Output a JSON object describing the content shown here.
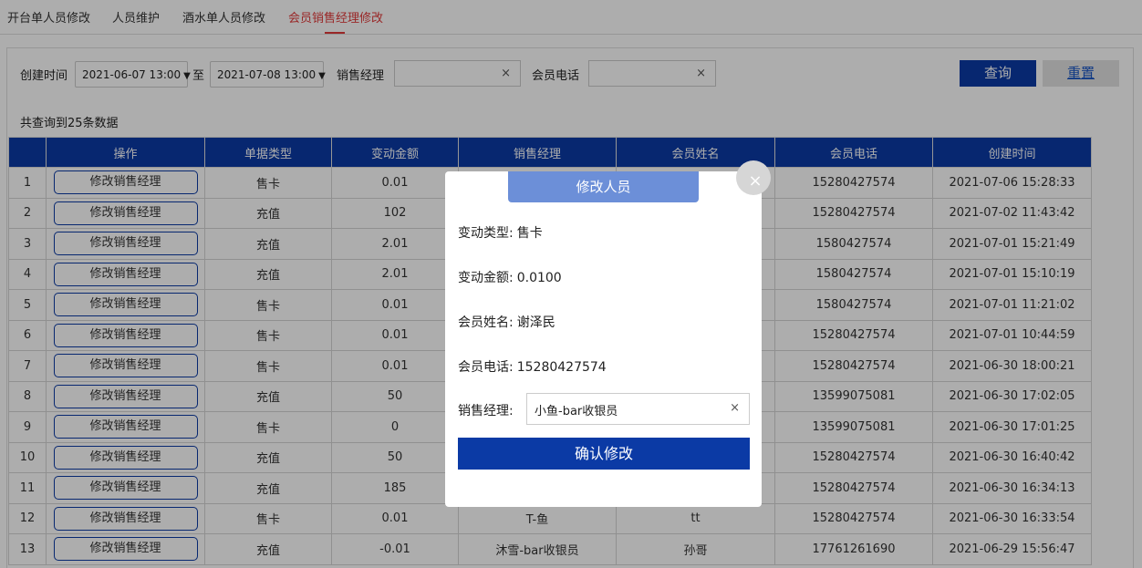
{
  "tabs": [
    {
      "label": "开台单人员修改"
    },
    {
      "label": "人员维护"
    },
    {
      "label": "酒水单人员修改"
    },
    {
      "label": "会员销售经理修改"
    }
  ],
  "filters": {
    "created_label": "创建时间",
    "start_date": "2021-06-07 13:00",
    "to_label": "至",
    "end_date": "2021-07-08 13:00",
    "manager_label": "销售经理",
    "manager_value": "",
    "phone_label": "会员电话",
    "phone_value": "",
    "query_label": "查询",
    "reset_label": "重置"
  },
  "result_count": "共查询到25条数据",
  "table": {
    "headers": [
      "操作",
      "单据类型",
      "变动金额",
      "销售经理",
      "会员姓名",
      "会员电话",
      "创建时间"
    ],
    "action_label": "修改销售经理",
    "rows": [
      {
        "no": "1",
        "type": "售卡",
        "amount": "0.01",
        "manager": "",
        "name": "",
        "phone": "15280427574",
        "time": "2021-07-06 15:28:33"
      },
      {
        "no": "2",
        "type": "充值",
        "amount": "102",
        "manager": "",
        "name": "",
        "phone": "15280427574",
        "time": "2021-07-02 11:43:42"
      },
      {
        "no": "3",
        "type": "充值",
        "amount": "2.01",
        "manager": "",
        "name": "",
        "phone": "1580427574",
        "time": "2021-07-01 15:21:49"
      },
      {
        "no": "4",
        "type": "充值",
        "amount": "2.01",
        "manager": "",
        "name": "",
        "phone": "1580427574",
        "time": "2021-07-01 15:10:19"
      },
      {
        "no": "5",
        "type": "售卡",
        "amount": "0.01",
        "manager": "",
        "name": "",
        "phone": "1580427574",
        "time": "2021-07-01 11:21:02"
      },
      {
        "no": "6",
        "type": "售卡",
        "amount": "0.01",
        "manager": "",
        "name": "",
        "phone": "15280427574",
        "time": "2021-07-01 10:44:59"
      },
      {
        "no": "7",
        "type": "售卡",
        "amount": "0.01",
        "manager": "",
        "name": "",
        "phone": "15280427574",
        "time": "2021-06-30 18:00:21"
      },
      {
        "no": "8",
        "type": "充值",
        "amount": "50",
        "manager": "",
        "name": "",
        "phone": "13599075081",
        "time": "2021-06-30 17:02:05"
      },
      {
        "no": "9",
        "type": "售卡",
        "amount": "0",
        "manager": "",
        "name": "",
        "phone": "13599075081",
        "time": "2021-06-30 17:01:25"
      },
      {
        "no": "10",
        "type": "充值",
        "amount": "50",
        "manager": "",
        "name": "",
        "phone": "15280427574",
        "time": "2021-06-30 16:40:42"
      },
      {
        "no": "11",
        "type": "充值",
        "amount": "185",
        "manager": "",
        "name": "",
        "phone": "15280427574",
        "time": "2021-06-30 16:34:13"
      },
      {
        "no": "12",
        "type": "售卡",
        "amount": "0.01",
        "manager": "T-鱼",
        "name": "tt",
        "phone": "15280427574",
        "time": "2021-06-30 16:33:54"
      },
      {
        "no": "13",
        "type": "充值",
        "amount": "-0.01",
        "manager": "沐雪-bar收银员",
        "name": "孙哥",
        "phone": "17761261690",
        "time": "2021-06-29 15:56:47"
      }
    ]
  },
  "modal": {
    "title": "修改人员",
    "close_glyph": "×",
    "type_label": "变动类型:",
    "type_value": "售卡",
    "amount_label": "变动金额:",
    "amount_value": "0.0100",
    "name_label": "会员姓名:",
    "name_value": "谢泽民",
    "phone_label": "会员电话:",
    "phone_value": "15280427574",
    "manager_label": "销售经理:",
    "manager_value": "小鱼-bar收银员",
    "confirm_label": "确认修改"
  },
  "colors": {
    "primary": "#0b3aa5",
    "active_tab": "#e23a3a",
    "modal_title_bg": "#6c8fd8"
  }
}
